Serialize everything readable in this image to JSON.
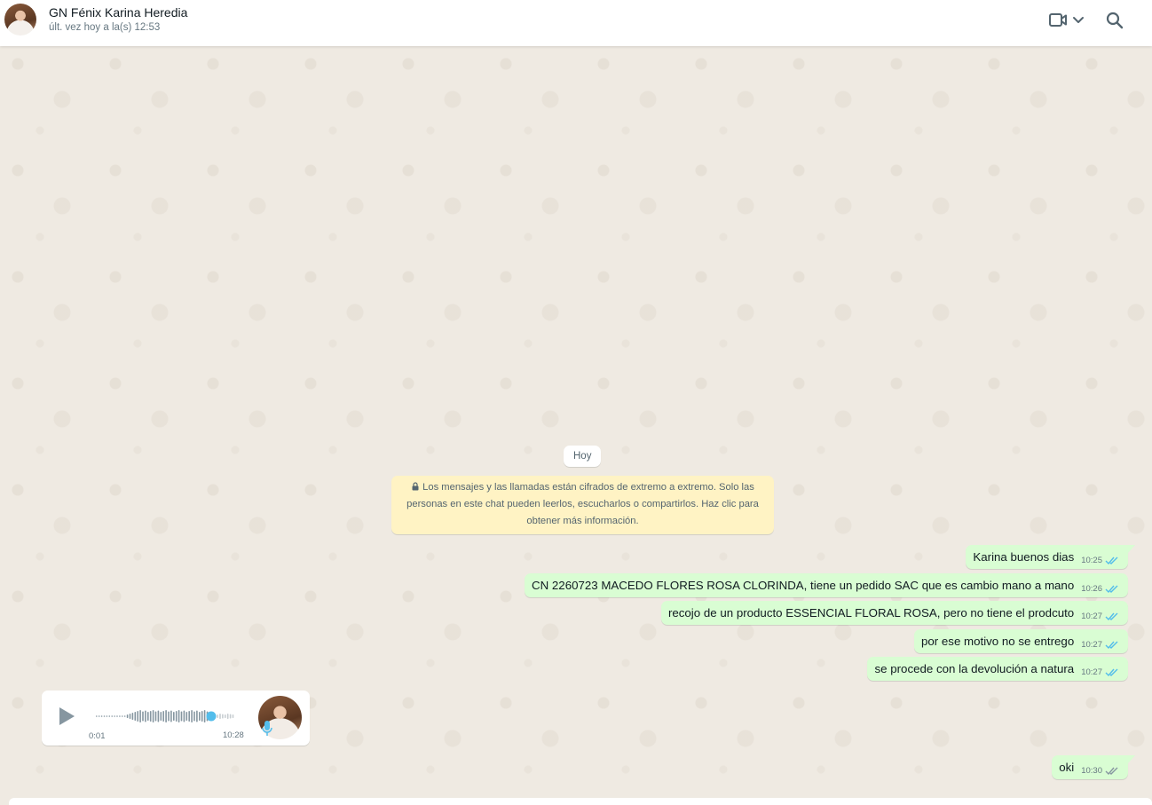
{
  "header": {
    "contact_name": "GN Fénix Karina Heredia",
    "status": "últ. vez hoy a la(s) 12:53",
    "video_icon": "video-camera-icon",
    "search_icon": "search-icon"
  },
  "chat": {
    "date_chip": "Hoy",
    "encryption_notice": "Los mensajes y las llamadas están cifrados de extremo a extremo. Solo las personas en este chat pueden leerlos, escucharlos o compartirlos. Haz clic para obtener más información.",
    "messages": [
      {
        "text": "Karina buenos dias",
        "time": "10:25",
        "status": "read"
      },
      {
        "text": "CN 2260723 MACEDO FLORES ROSA CLORINDA, tiene un pedido SAC que es cambio mano a mano",
        "time": "10:26",
        "status": "read"
      },
      {
        "text": "recojo de un producto ESSENCIAL FLORAL ROSA, pero no tiene el prodcuto",
        "time": "10:27",
        "status": "read"
      },
      {
        "text": "por ese motivo no se entrego",
        "time": "10:27",
        "status": "read"
      },
      {
        "text": "se procede con la devolución a natura",
        "time": "10:27",
        "status": "read"
      },
      {
        "text": "oki",
        "time": "10:30",
        "status": "delivered"
      }
    ],
    "voice_message": {
      "elapsed": "0:01",
      "time": "10:28",
      "progress": 0.83
    }
  },
  "colors": {
    "outgoing_bubble": "#d9fdd3",
    "read_ticks": "#53bdeb",
    "delivered_ticks": "#8696a0",
    "notice_bg": "#fff3c4",
    "chat_bg": "#efeae2"
  }
}
